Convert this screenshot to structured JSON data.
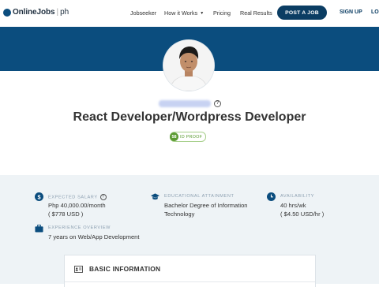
{
  "nav": {
    "logo_text": "OnlineJobs",
    "logo_sep": "|",
    "logo_suffix": "ph",
    "links": [
      "Jobseeker",
      "How it Works",
      "Pricing",
      "Real Results"
    ],
    "post_job": "POST A JOB",
    "signup": "SIGN UP",
    "login": "LO"
  },
  "profile": {
    "title": "React Developer/Wordpress Developer",
    "id_proof_score": "58",
    "id_proof_label": "ID PROOF",
    "help_mark": "?"
  },
  "details": {
    "salary": {
      "label": "EXPECTED SALARY",
      "line1": "Php 40,000.00/month",
      "line2": "( $778 USD )"
    },
    "education": {
      "label": "EDUCATIONAL ATTAINMENT",
      "line1": "Bachelor Degree of Information",
      "line2": "Technology"
    },
    "availability": {
      "label": "AVAILABILITY",
      "line1": "40 hrs/wk",
      "line2": "( $4.50 USD/hr )"
    },
    "experience": {
      "label": "EXPERIENCE OVERVIEW",
      "line1": "7 years on Web/App Development"
    }
  },
  "basic_info": {
    "title": "BASIC INFORMATION"
  },
  "colors": {
    "brand": "#0b4d7e",
    "post_button": "#0b3d63",
    "id_proof": "#5b9b33",
    "details_bg": "#eef3f6"
  }
}
